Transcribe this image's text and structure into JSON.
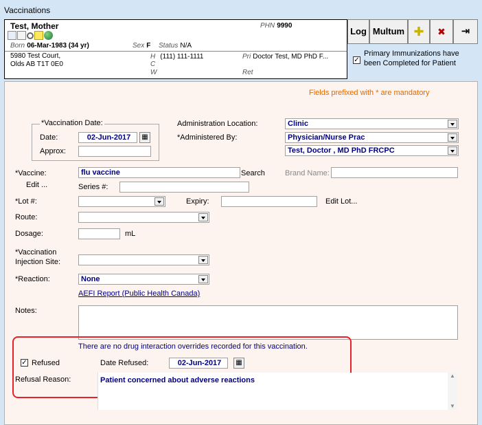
{
  "window": {
    "title": "Vaccinations"
  },
  "patient": {
    "name": "Test, Mother",
    "phn_label": "PHN",
    "phn": "9990",
    "born_label": "Born",
    "born": "06-Mar-1983 (34 yr)",
    "sex_label": "Sex",
    "sex": "F",
    "status_label": "Status",
    "status": "N/A",
    "address_line1": "5980 Test Court,",
    "address_line2": "Olds AB  T1T 0E0",
    "h_label": "H",
    "phone_h": "(111) 111-1111",
    "c_label": "C",
    "w_label": "W",
    "pri_label": "Pri",
    "pri": "Doctor Test, MD PhD F...",
    "ret_label": "Ret"
  },
  "toolbar": {
    "log": "Log",
    "multum": "Multum",
    "primary_immunizations": "Primary Immunizations have been Completed for Patient"
  },
  "form": {
    "mandatory_note": "Fields prefixed with * are mandatory",
    "vaccination_date_group": "*Vaccination Date:",
    "date_label": "Date:",
    "date_value": "02-Jun-2017",
    "approx_label": "Approx:",
    "admin_location_label": "Administration Location:",
    "admin_location_value": "Clinic",
    "administered_by_label": "*Administered By:",
    "administered_by_value": "Physician/Nurse Prac",
    "administered_by_person": "Test, Doctor , MD PhD FRCPC",
    "vaccine_label": "*Vaccine:",
    "vaccine_value": "flu vaccine",
    "search_label": "Search",
    "brand_name_label": "Brand Name:",
    "edit_label": "Edit ...",
    "series_label": "Series #:",
    "lot_label": "*Lot #:",
    "expiry_label": "Expiry:",
    "edit_lot_label": "Edit Lot...",
    "route_label": "Route:",
    "dosage_label": "Dosage:",
    "ml_label": "mL",
    "injection_site_label_1": "*Vaccination",
    "injection_site_label_2": "Injection Site:",
    "reaction_label": "*Reaction:",
    "reaction_value": "None",
    "aefi_link": "AEFI Report (Public Health Canada)",
    "notes_label": "Notes:",
    "interaction_note": "There are no drug interaction overrides recorded for this vaccination.",
    "refused_label": "Refused",
    "date_refused_label": "Date Refused:",
    "date_refused_value": "02-Jun-2017",
    "refusal_reason_label": "Refusal Reason:",
    "refusal_reason_value": "Patient concerned about adverse reactions"
  }
}
